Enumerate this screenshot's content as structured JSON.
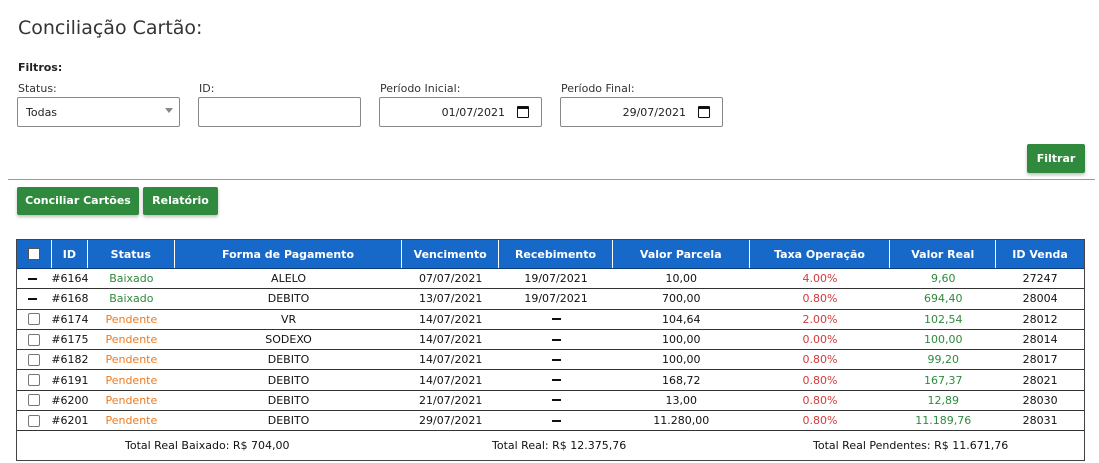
{
  "page": {
    "title": "Conciliação Cartão:"
  },
  "filters": {
    "label": "Filtros:",
    "status": {
      "label": "Status:",
      "value": "Todas"
    },
    "id": {
      "label": "ID:",
      "value": ""
    },
    "periodo_inicial": {
      "label": "Período Inicial:",
      "value": "01/07/2021"
    },
    "periodo_final": {
      "label": "Período Final:",
      "value": "29/07/2021"
    },
    "filtrar_label": "Filtrar"
  },
  "actions": {
    "conciliar_label": "Conciliar Cartões",
    "relatorio_label": "Relatório"
  },
  "table": {
    "headers": [
      "ID",
      "Status",
      "Forma de Pagamento",
      "Vencimento",
      "Recebimento",
      "Valor Parcela",
      "Taxa Operação",
      "Valor Real",
      "ID Venda"
    ],
    "rows": [
      {
        "id": "#6164",
        "status": "Baixado",
        "forma": "ALELO",
        "vencimento": "07/07/2021",
        "recebimento": "19/07/2021",
        "parcela": "10,00",
        "taxa": "4.00%",
        "real": "9,60",
        "venda": "27247"
      },
      {
        "id": "#6168",
        "status": "Baixado",
        "forma": "DEBITO",
        "vencimento": "13/07/2021",
        "recebimento": "19/07/2021",
        "parcela": "700,00",
        "taxa": "0.80%",
        "real": "694,40",
        "venda": "28004"
      },
      {
        "id": "#6174",
        "status": "Pendente",
        "forma": "VR",
        "vencimento": "14/07/2021",
        "recebimento": "",
        "parcela": "104,64",
        "taxa": "2.00%",
        "real": "102,54",
        "venda": "28012"
      },
      {
        "id": "#6175",
        "status": "Pendente",
        "forma": "SODEXO",
        "vencimento": "14/07/2021",
        "recebimento": "",
        "parcela": "100,00",
        "taxa": "0.00%",
        "real": "100,00",
        "venda": "28014"
      },
      {
        "id": "#6182",
        "status": "Pendente",
        "forma": "DEBITO",
        "vencimento": "14/07/2021",
        "recebimento": "",
        "parcela": "100,00",
        "taxa": "0.80%",
        "real": "99,20",
        "venda": "28017"
      },
      {
        "id": "#6191",
        "status": "Pendente",
        "forma": "DEBITO",
        "vencimento": "14/07/2021",
        "recebimento": "",
        "parcela": "168,72",
        "taxa": "0.80%",
        "real": "167,37",
        "venda": "28021"
      },
      {
        "id": "#6200",
        "status": "Pendente",
        "forma": "DEBITO",
        "vencimento": "21/07/2021",
        "recebimento": "",
        "parcela": "13,00",
        "taxa": "0.80%",
        "real": "12,89",
        "venda": "28030"
      },
      {
        "id": "#6201",
        "status": "Pendente",
        "forma": "DEBITO",
        "vencimento": "29/07/2021",
        "recebimento": "",
        "parcela": "11.280,00",
        "taxa": "0.80%",
        "real": "11.189,76",
        "venda": "28031"
      }
    ],
    "totals": {
      "baixado": "Total Real Baixado: R$ 704,00",
      "total": "Total Real: R$ 12.375,76",
      "pendentes": "Total Real Pendentes: R$ 11.671,76"
    }
  },
  "colors": {
    "header_bg": "#1769c9",
    "button_bg": "#2f8a3e",
    "baixado": "#2f8a3e",
    "pendente": "#ee7a1e",
    "taxa": "#d13b3b"
  }
}
